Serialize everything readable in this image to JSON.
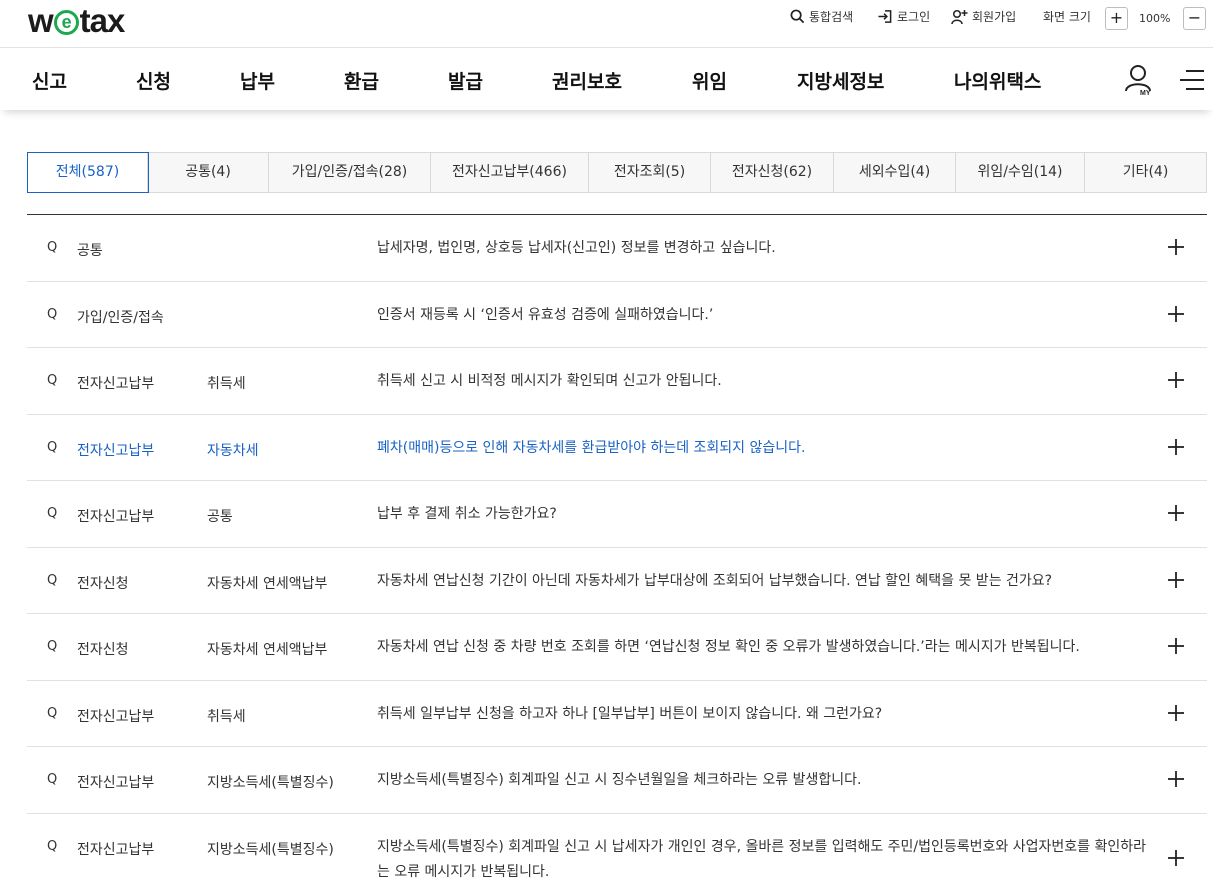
{
  "brand": {
    "logo_pre": "w",
    "logo_mark": "e",
    "logo_post": "tax"
  },
  "util": {
    "search": "통합검색",
    "login": "로그인",
    "signup": "회원가입",
    "zoom_label": "화면 크기",
    "zoom_in": "+",
    "zoom_value": "100%",
    "zoom_out": "−"
  },
  "nav": {
    "items": [
      "신고",
      "신청",
      "납부",
      "환급",
      "발급",
      "권리보호",
      "위임",
      "지방세정보",
      "나의위택스"
    ],
    "my_label": "MY"
  },
  "tabs": [
    {
      "label": "전체(587)",
      "active": true
    },
    {
      "label": "공통(4)"
    },
    {
      "label": "가입/인증/접속(28)"
    },
    {
      "label": "전자신고납부(466)"
    },
    {
      "label": "전자조회(5)"
    },
    {
      "label": "전자신청(62)"
    },
    {
      "label": "세외수입(4)"
    },
    {
      "label": "위임/수임(14)"
    },
    {
      "label": "기타(4)"
    }
  ],
  "faq": [
    {
      "q": "Q",
      "category": "공통",
      "sub": "",
      "title": "납세자명, 법인명, 상호등 납세자(신고인) 정보를 변경하고 싶습니다."
    },
    {
      "q": "Q",
      "category": "가입/인증/접속",
      "sub": "",
      "title": "인증서 재등록 시 ‘인증서 유효성 검증에 실패하였습니다.’"
    },
    {
      "q": "Q",
      "category": "전자신고납부",
      "sub": "취득세",
      "title": "취득세 신고 시 비적정 메시지가 확인되며 신고가 안됩니다."
    },
    {
      "q": "Q",
      "category": "전자신고납부",
      "sub": "자동차세",
      "title": "폐차(매매)등으로 인해 자동차세를 환급받아야 하는데 조회되지 않습니다."
    },
    {
      "q": "Q",
      "category": "전자신고납부",
      "sub": "공통",
      "title": "납부 후 결제 취소 가능한가요?"
    },
    {
      "q": "Q",
      "category": "전자신청",
      "sub": "자동차세 연세액납부",
      "title": "자동차세 연납신청 기간이 아닌데 자동차세가 납부대상에 조회되어 납부했습니다. 연납 할인 혜택을 못 받는 건가요?"
    },
    {
      "q": "Q",
      "category": "전자신청",
      "sub": "자동차세 연세액납부",
      "title": "자동차세 연납 신청 중 차량 번호 조회를 하면 ‘연납신청 정보 확인 중 오류가 발생하였습니다.’라는 메시지가 반복됩니다."
    },
    {
      "q": "Q",
      "category": "전자신고납부",
      "sub": "취득세",
      "title": "취득세 일부납부 신청을 하고자 하나 [일부납부] 버튼이 보이지 않습니다. 왜 그런가요?"
    },
    {
      "q": "Q",
      "category": "전자신고납부",
      "sub": "지방소득세(특별징수)",
      "title": "지방소득세(특별징수) 회계파일 신고 시 징수년월일을 체크하라는 오류 발생합니다."
    },
    {
      "q": "Q",
      "category": "전자신고납부",
      "sub": "지방소득세(특별징수)",
      "title": "지방소득세(특별징수) 회계파일 신고 시 납세자가 개인인 경우, 올바른 정보를 입력해도 주민/법인등록번호와 사업자번호를 확인하라는 오류 메시지가 반복됩니다."
    }
  ],
  "colors": {
    "accent": "#1a62c5",
    "brand_green": "#1ca84e"
  }
}
